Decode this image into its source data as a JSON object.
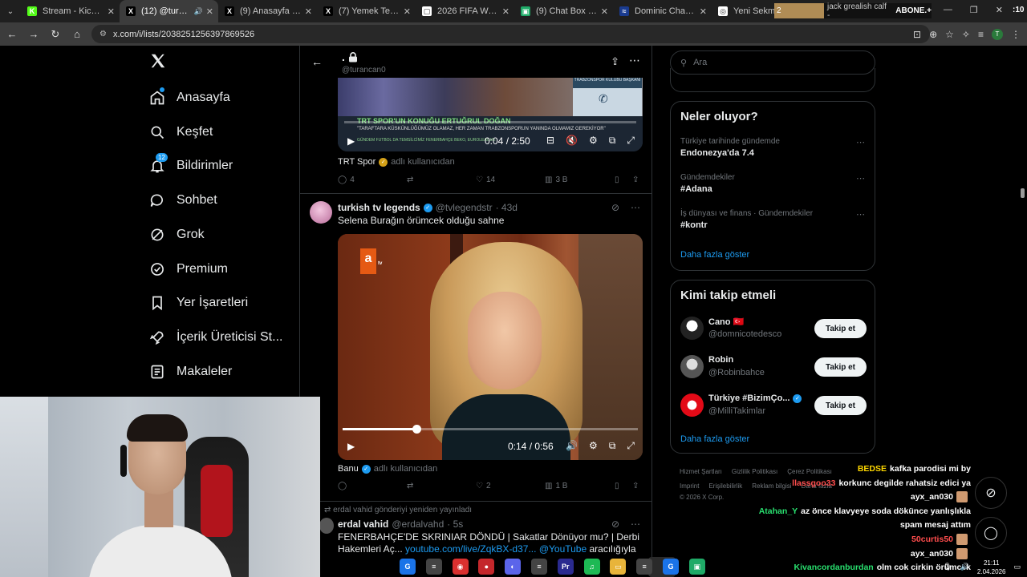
{
  "browser": {
    "tabs": [
      {
        "label": "Stream - Kick Dashbo",
        "color": "#53fc18",
        "glyph": "K"
      },
      {
        "label": "(12) @turancan0",
        "color": "#000000",
        "glyph": "X",
        "active": true
      },
      {
        "label": "(9) Anasayfa / X",
        "color": "#000000",
        "glyph": "X"
      },
      {
        "label": "(7) Yemek Terörü (@y",
        "color": "#000000",
        "glyph": "X"
      },
      {
        "label": "2026 FIFA World Cup",
        "color": "#ffffff",
        "glyph": "▢"
      },
      {
        "label": "(9) Chat Box / Stream",
        "color": "#1faa67",
        "glyph": "▣"
      },
      {
        "label": "Dominic Chanda - Op",
        "color": "#1a3b8f",
        "glyph": "≈"
      },
      {
        "label": "Yeni Sekme",
        "color": "#ffffff",
        "glyph": "◎"
      }
    ],
    "banner": {
      "left": "2",
      "mid": "jack grealish calf -",
      "bold": "ABONE.+",
      "count": ":10"
    },
    "url": "x.com/i/lists/2038251256397869526"
  },
  "nav": {
    "items": [
      {
        "label": "Anasayfa",
        "icon": "home-icon"
      },
      {
        "label": "Keşfet",
        "icon": "search-icon"
      },
      {
        "label": "Bildirimler",
        "icon": "bell-icon",
        "badge": "12"
      },
      {
        "label": "Sohbet",
        "icon": "chat-icon"
      },
      {
        "label": "Grok",
        "icon": "grok-icon"
      },
      {
        "label": "Premium",
        "icon": "premium-icon"
      },
      {
        "label": "Yer İşaretleri",
        "icon": "bookmark-icon"
      },
      {
        "label": "İçerik Üreticisi St...",
        "icon": "rocket-icon"
      },
      {
        "label": "Makaleler",
        "icon": "article-icon"
      }
    ]
  },
  "timeline": {
    "header": {
      "title": ".",
      "handle": "@turancan0"
    },
    "tweet1": {
      "video_headline": "TRT SPOR'UN KONUĞU ERTUĞRUL DOĞAN",
      "video_sub": "\"TARAFTARA KÜSKÜNLÜĞÜMÜZ OLAMAZ, HER ZAMAN TRABZONSPORUN YANINDA OLMAMIZ GEREKİYOR\"",
      "video_ticker": "GÜNDEM FUTBOL   DA TEMSİLCİMİZ FENERBAHÇE BEKO, EUROLEAGUE",
      "video_box_label": "TRABZONSPOR KULÜBÜ BAŞKANI",
      "time": "0:04 / 2:50",
      "source_name": "TRT Spor",
      "source_suffix": "adlı kullanıcıdan",
      "replies": "4",
      "likes": "14",
      "views": "3 B"
    },
    "tweet2": {
      "name": "turkish tv legends",
      "handle": "@tvlegendstr",
      "age": "· 43d",
      "text": "Selena Burağın örümcek olduğu sahne",
      "time": "0:14 / 0:56",
      "progress": 0.25,
      "logo": "a",
      "logo_sub": "tv",
      "source_name": "Banu",
      "source_suffix": "adlı kullanıcıdan",
      "likes": "2",
      "views": "1 B"
    },
    "tweet3": {
      "retweet_line": "erdal vahid gönderiyi yeniden yayınladı",
      "name": "erdal vahid",
      "handle": "@erdalvahd",
      "age": "· 5s",
      "line1": "FENERBAHÇE'DE SKRINIAR DÖNDÜ | Sakatlar Dönüyor mu? | Derbi",
      "line2_start": "Hakemleri Aç...",
      "link": "youtube.com/live/ZqkBX-d37...",
      "mention": "@YouTube",
      "line2_end": "aracılığıyla"
    }
  },
  "right": {
    "search_placeholder": "Ara",
    "trends_title": "Neler oluyor?",
    "trends": [
      {
        "meta": "Türkiye tarihinde gündemde",
        "name": "Endonezya'da 7.4"
      },
      {
        "meta": "Gündemdekiler",
        "name": "#Adana"
      },
      {
        "meta": "İş dünyası ve finans · Gündemdekiler",
        "name": "#kontr"
      }
    ],
    "show_more": "Daha fazla göster",
    "follow_title": "Kimi takip etmeli",
    "follow": [
      {
        "name": "Cano 🇹🇷",
        "handle": "@domnicotedesco",
        "btn": "Takip et"
      },
      {
        "name": "Robin",
        "handle": "@Robinbahce",
        "btn": "Takip et"
      },
      {
        "name": "Türkiye #BizimÇo...",
        "handle": "@MilliTakimlar",
        "btn": "Takip et",
        "verified": true
      }
    ],
    "footer_row1": [
      "Hizmet Şartları",
      "Gizlilik Politikası",
      "Çerez Politikası"
    ],
    "footer_row2": [
      "Imprint",
      "Erişilebilirlik",
      "Reklam bilgisi",
      "Daha fazla"
    ],
    "copyright": "© 2026 X Corp."
  },
  "chat": [
    {
      "user": "BEDSE",
      "color": "#ffd800",
      "msg": "kafka parodisi mi by"
    },
    {
      "user": "llassgoo33",
      "color": "#ff4d4d",
      "msg": "korkunc degilde rahatsiz edici ya"
    },
    {
      "user": "ayx_an030",
      "color": "#ffffff",
      "msg": "",
      "emote": true
    },
    {
      "user": "Atahan_Y",
      "color": "#29e06f",
      "msg": "az önce klavyeye soda dökünce yanlışlıkla"
    },
    {
      "user": "",
      "color": "#ffffff",
      "msg": "spam mesaj attım"
    },
    {
      "user": "50curtis50",
      "color": "#ff4d4d",
      "msg": "",
      "emote": true
    },
    {
      "user": "ayx_an030",
      "color": "#ffffff",
      "msg": "",
      "emote": true
    },
    {
      "user": "Kivancordanburdan",
      "color": "#29e06f",
      "msg": "olm cok cirkin örümcek"
    }
  ],
  "taskbar": {
    "icons": [
      {
        "color": "#1a73e8",
        "glyph": "G"
      },
      {
        "color": "#444444",
        "glyph": "≡"
      },
      {
        "color": "#d9302f",
        "glyph": "◉"
      },
      {
        "color": "#c4272b",
        "glyph": "●"
      },
      {
        "color": "#5b65ea",
        "glyph": "◐"
      },
      {
        "color": "#444444",
        "glyph": "≡"
      },
      {
        "color": "#2a2a8f",
        "glyph": "Pr"
      },
      {
        "color": "#1db954",
        "glyph": "♫"
      },
      {
        "color": "#e8b43a",
        "glyph": "▭"
      },
      {
        "color": "#444444",
        "glyph": "≡"
      },
      {
        "color": "#1a73e8",
        "glyph": "G"
      },
      {
        "color": "#1faa67",
        "glyph": "▣"
      }
    ],
    "time": "21:11",
    "date": "2.04.2026"
  }
}
